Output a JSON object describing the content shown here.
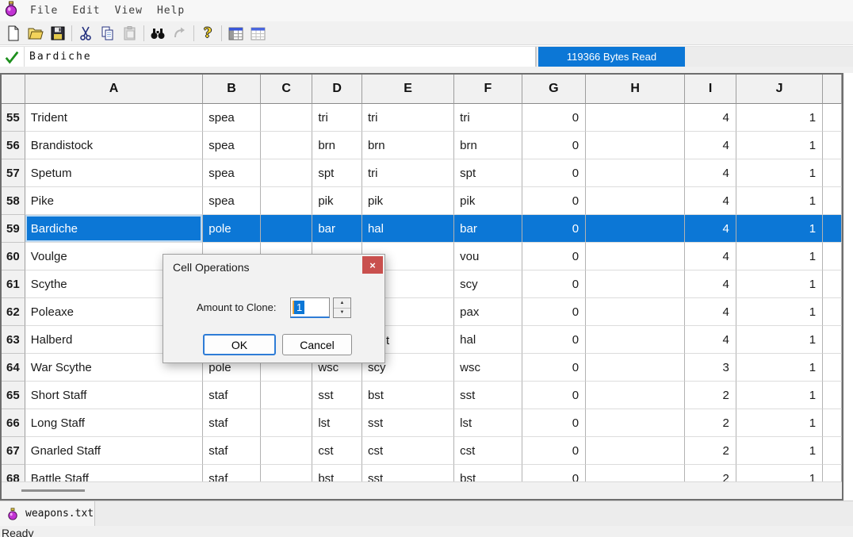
{
  "menu": {
    "items": [
      "File",
      "Edit",
      "View",
      "Help"
    ]
  },
  "toolbar": {
    "icons": [
      "new-file-icon",
      "open-file-icon",
      "save-file-icon",
      "cut-icon",
      "copy-icon",
      "paste-icon",
      "find-icon",
      "find-next-icon",
      "help-icon",
      "table-columns-icon",
      "table-grid-icon"
    ],
    "help_glyph": "?"
  },
  "formula_bar": {
    "value": "Bardiche",
    "progress_text": "119366 Bytes Read"
  },
  "sheet": {
    "columns": [
      "A",
      "B",
      "C",
      "D",
      "E",
      "F",
      "G",
      "H",
      "I",
      "J"
    ],
    "selected_row_num": "59",
    "covered_fragment": "t",
    "rows": [
      {
        "num": "55",
        "cells": [
          "Trident",
          "spea",
          "",
          "tri",
          "tri",
          "tri",
          "0",
          "",
          "4",
          "1",
          ""
        ]
      },
      {
        "num": "56",
        "cells": [
          "Brandistock",
          "spea",
          "",
          "brn",
          "brn",
          "brn",
          "0",
          "",
          "4",
          "1",
          ""
        ]
      },
      {
        "num": "57",
        "cells": [
          "Spetum",
          "spea",
          "",
          "spt",
          "tri",
          "spt",
          "0",
          "",
          "4",
          "1",
          ""
        ]
      },
      {
        "num": "58",
        "cells": [
          "Pike",
          "spea",
          "",
          "pik",
          "pik",
          "pik",
          "0",
          "",
          "4",
          "1",
          ""
        ]
      },
      {
        "num": "59",
        "cells": [
          "Bardiche",
          "pole",
          "",
          "bar",
          "hal",
          "bar",
          "0",
          "",
          "4",
          "1",
          ""
        ]
      },
      {
        "num": "60",
        "cells": [
          "Voulge",
          "",
          "",
          "",
          "",
          "vou",
          "0",
          "",
          "4",
          "1",
          ""
        ]
      },
      {
        "num": "61",
        "cells": [
          "Scythe",
          "",
          "",
          "",
          "",
          "scy",
          "0",
          "",
          "4",
          "1",
          ""
        ]
      },
      {
        "num": "62",
        "cells": [
          "Poleaxe",
          "",
          "",
          "",
          "",
          "pax",
          "0",
          "",
          "4",
          "1",
          ""
        ]
      },
      {
        "num": "63",
        "cells": [
          "Halberd",
          "",
          "",
          "",
          "",
          "hal",
          "0",
          "",
          "4",
          "1",
          ""
        ]
      },
      {
        "num": "64",
        "cells": [
          "War Scythe",
          "pole",
          "",
          "wsc",
          "scy",
          "wsc",
          "0",
          "",
          "3",
          "1",
          ""
        ]
      },
      {
        "num": "65",
        "cells": [
          "Short Staff",
          "staf",
          "",
          "sst",
          "bst",
          "sst",
          "0",
          "",
          "2",
          "1",
          ""
        ]
      },
      {
        "num": "66",
        "cells": [
          "Long Staff",
          "staf",
          "",
          "lst",
          "sst",
          "lst",
          "0",
          "",
          "2",
          "1",
          ""
        ]
      },
      {
        "num": "67",
        "cells": [
          "Gnarled Staff",
          "staf",
          "",
          "cst",
          "cst",
          "cst",
          "0",
          "",
          "2",
          "1",
          ""
        ]
      },
      {
        "num": "68",
        "cells": [
          "Battle Staff",
          "staf",
          "",
          "bst",
          "sst",
          "bst",
          "0",
          "",
          "2",
          "1",
          ""
        ]
      }
    ]
  },
  "dialog": {
    "title": "Cell Operations",
    "close_glyph": "×",
    "field_label": "Amount to Clone:",
    "field_value": "1",
    "spin_up_glyph": "▲",
    "spin_down_glyph": "▼",
    "ok_label": "OK",
    "cancel_label": "Cancel"
  },
  "tabs": {
    "active_label": "weapons.txt"
  },
  "status": {
    "text": "Ready"
  },
  "colors": {
    "accent": "#0c77d6",
    "close_red": "#c9504e",
    "potion_purple": "#c233d4"
  }
}
